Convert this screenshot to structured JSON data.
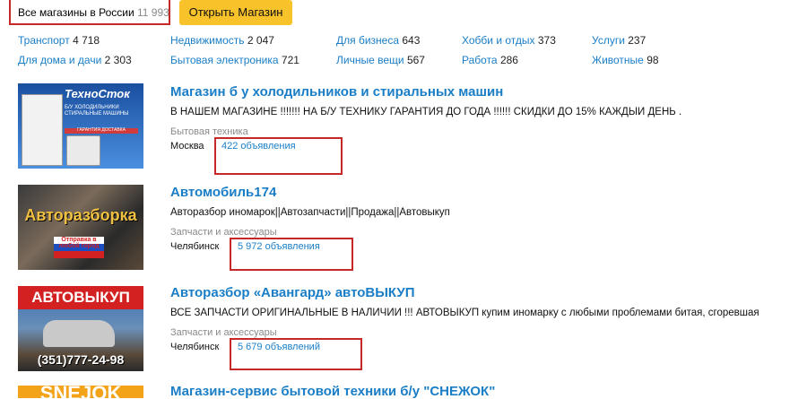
{
  "top": {
    "all_shops_label": "Все магазины в России",
    "all_shops_count": "11 993",
    "open_shop_button": "Открыть Магазин"
  },
  "categories": [
    {
      "label": "Транспорт",
      "count": "4 718"
    },
    {
      "label": "Недвижимость",
      "count": "2 047"
    },
    {
      "label": "Для бизнеса",
      "count": "643"
    },
    {
      "label": "Хобби и отдых",
      "count": "373"
    },
    {
      "label": "Услуги",
      "count": "237"
    },
    {
      "label": "Для дома и дачи",
      "count": "2 303"
    },
    {
      "label": "Бытовая электроника",
      "count": "721"
    },
    {
      "label": "Личные вещи",
      "count": "567"
    },
    {
      "label": "Работа",
      "count": "286"
    },
    {
      "label": "Животные",
      "count": "98"
    }
  ],
  "listings": [
    {
      "title": "Магазин б у холодильников и стиральных машин",
      "description": "В НАШЕМ МАГАЗИНЕ !!!!!!! НА Б/У ТЕХНИКУ ГАРАНТИЯ ДО ГОДА !!!!!! СКИДКИ ДО 15% КАЖДЫЙ ДЕНЬ .",
      "category": "Бытовая техника",
      "city": "Москва",
      "ads": "422 объявления",
      "thumb": {
        "logo": "ТехноСток",
        "text": "Б/У ХОЛОДИЛЬНИКИ СТИРАЛЬНЫЕ МАШИНЫ",
        "band": "ГАРАНТИЯ ДОСТАВКА"
      }
    },
    {
      "title": "Автомобиль174",
      "description": "Авторазбор иномарок||Автозапчасти||Продажа||Автовыкуп",
      "category": "Запчасти и аксессуары",
      "city": "Челябинск",
      "ads": "5 972 объявления",
      "thumb": {
        "big": "Авторазборка",
        "sub": "Отправка в любой город"
      }
    },
    {
      "title": "Авторазбор «Авангард» автоВЫКУП",
      "description": "ВСЕ ЗАПЧАСТИ ОРИГИНАЛЬНЫЕ В НАЛИЧИИ !!! АВТОВЫКУП купим иномарку с любыми проблемами битая, сгоревшая",
      "category": "Запчасти и аксессуары",
      "city": "Челябинск",
      "ads": "5 679 объявлений",
      "thumb": {
        "header": "АВТОВЫКУП",
        "phone": "(351)777-24-98"
      }
    },
    {
      "title": "Магазин-сервис бытовой техники б/у \"СНЕЖОК\"",
      "thumb": {
        "big": "SNEJOK"
      }
    }
  ],
  "colors": {
    "link": "#1a7ec7",
    "button": "#f8c22a",
    "highlight": "#c62828"
  }
}
